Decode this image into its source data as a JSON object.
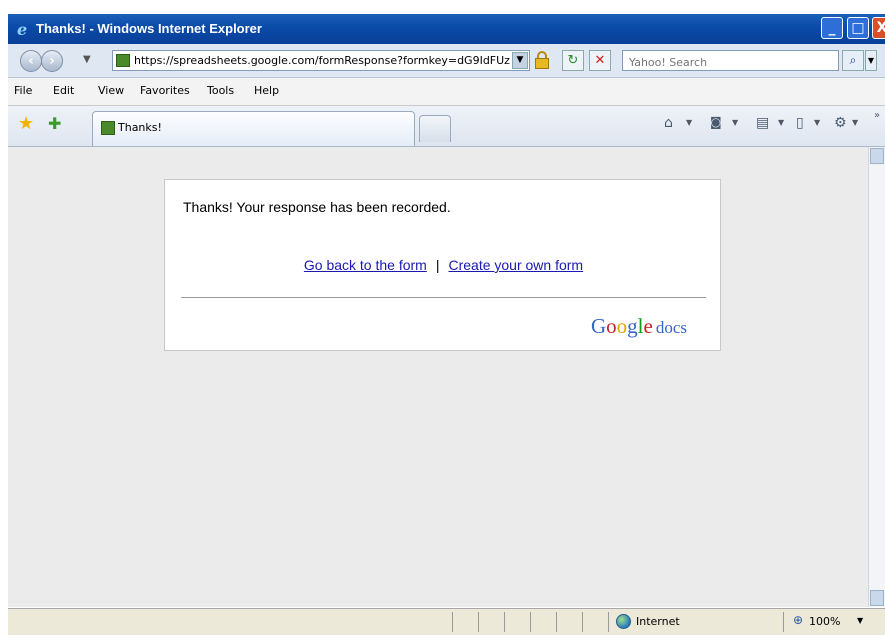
{
  "window": {
    "title": "Thanks! - Windows Internet Explorer",
    "controls": {
      "minimize": "_",
      "maximize": "□",
      "close": "X"
    }
  },
  "address_bar": {
    "url": "https://spreadsheets.google.com/formResponse?formkey=dG9IdFUz",
    "search_placeholder": "Yahoo! Search",
    "back_icon": "back-arrow-icon",
    "forward_icon": "forward-arrow-icon"
  },
  "menu": {
    "items": [
      "File",
      "Edit",
      "View",
      "Favorites",
      "Tools",
      "Help"
    ]
  },
  "tabs": {
    "active_label": "Thanks!"
  },
  "page": {
    "message": "Thanks! Your response has been recorded.",
    "link_back": "Go back to the form",
    "link_separator": "|",
    "link_create": "Create your own form",
    "brand_letters": [
      "G",
      "o",
      "o",
      "g",
      "l",
      "e"
    ],
    "brand_colors": [
      "#3366cc",
      "#cc2222",
      "#e8a400",
      "#3366cc",
      "#119911",
      "#cc2222"
    ],
    "brand_suffix": "docs"
  },
  "status_bar": {
    "zone": "Internet",
    "zoom": "100%"
  },
  "colors": {
    "titlebar": "#0b4aa8",
    "link": "#1a1ab0",
    "content_bg": "#ebebeb"
  }
}
